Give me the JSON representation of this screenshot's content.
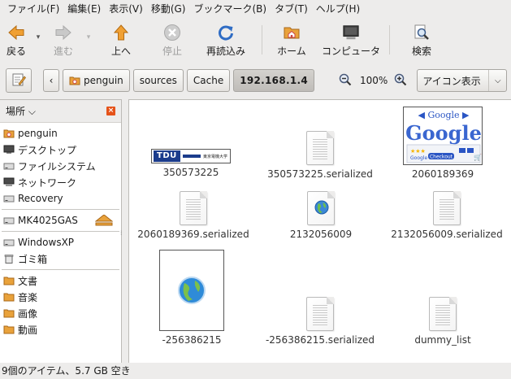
{
  "menubar": {
    "items": [
      "ファイル(F)",
      "編集(E)",
      "表示(V)",
      "移動(G)",
      "ブックマーク(B)",
      "タブ(T)",
      "ヘルプ(H)"
    ]
  },
  "toolbar": {
    "back": "戻る",
    "forward": "進む",
    "up": "上へ",
    "stop": "停止",
    "reload": "再読込み",
    "home": "ホーム",
    "computer": "コンピュータ",
    "search": "検索"
  },
  "location": {
    "crumbs": [
      "penguin",
      "sources",
      "Cache",
      "192.168.1.4"
    ],
    "zoom": "100%",
    "view_mode": "アイコン表示"
  },
  "sidebar": {
    "title": "場所",
    "items": [
      "penguin",
      "デスクトップ",
      "ファイルシステム",
      "ネットワーク",
      "Recovery",
      "MK4025GAS",
      "WindowsXP",
      "ゴミ箱",
      "文書",
      "音楽",
      "画像",
      "動画"
    ]
  },
  "files": [
    {
      "name": "350573225",
      "kind": "tdu-thumb"
    },
    {
      "name": "350573225.serialized",
      "kind": "document"
    },
    {
      "name": "2060189369",
      "kind": "google-thumb"
    },
    {
      "name": "2060189369.serialized",
      "kind": "document"
    },
    {
      "name": "2132056009",
      "kind": "globe-doc"
    },
    {
      "name": "2132056009.serialized",
      "kind": "document"
    },
    {
      "name": "-256386215",
      "kind": "globe-thumb"
    },
    {
      "name": "-256386215.serialized",
      "kind": "document"
    },
    {
      "name": "dummy_list",
      "kind": "document"
    }
  ],
  "thumbs": {
    "tdu_logo": "TDU",
    "tdu_jp": "東京電機大学",
    "google_word": "Google",
    "google_checkout": "Checkout"
  },
  "status": "9個のアイテム、5.7 GB 空き",
  "colors": {
    "accent_orange": "#e5531a",
    "folder_orange": "#e9a23b",
    "link_blue": "#1b3c8c"
  }
}
